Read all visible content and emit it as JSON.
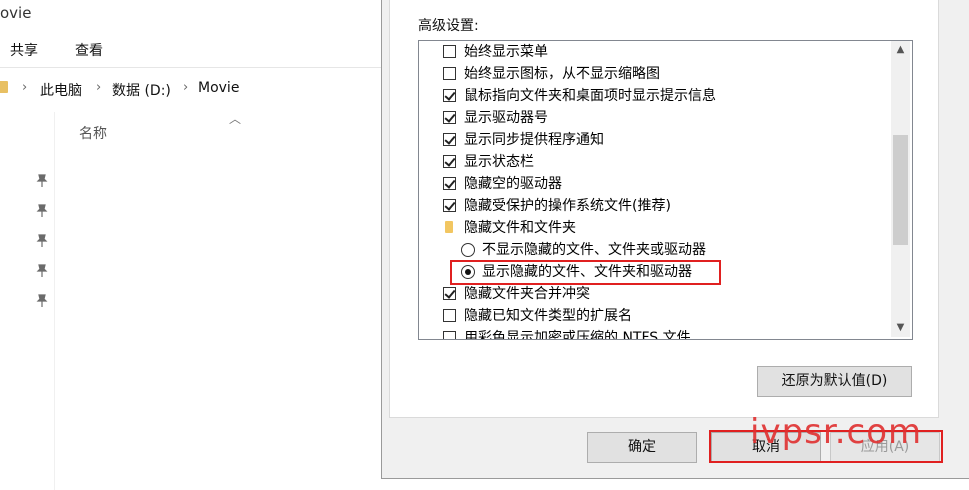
{
  "explorer": {
    "title": "ovie",
    "ribbon_tabs": [
      "共享",
      "查看"
    ],
    "breadcrumb": [
      "此电脑",
      "数据 (D:)",
      "Movie"
    ],
    "column_header": "名称",
    "pinned_count": 5
  },
  "dialog": {
    "advanced_label": "高级设置:",
    "items": [
      {
        "type": "checkbox",
        "checked": false,
        "label": "始终显示菜单"
      },
      {
        "type": "checkbox",
        "checked": false,
        "label": "始终显示图标，从不显示缩略图"
      },
      {
        "type": "checkbox",
        "checked": true,
        "label": "鼠标指向文件夹和桌面项时显示提示信息"
      },
      {
        "type": "checkbox",
        "checked": true,
        "label": "显示驱动器号"
      },
      {
        "type": "checkbox",
        "checked": true,
        "label": "显示同步提供程序通知"
      },
      {
        "type": "checkbox",
        "checked": true,
        "label": "显示状态栏"
      },
      {
        "type": "checkbox",
        "checked": true,
        "label": "隐藏空的驱动器"
      },
      {
        "type": "checkbox",
        "checked": true,
        "label": "隐藏受保护的操作系统文件(推荐)"
      },
      {
        "type": "folder",
        "label": "隐藏文件和文件夹"
      },
      {
        "type": "radio",
        "checked": false,
        "label": "不显示隐藏的文件、文件夹或驱动器"
      },
      {
        "type": "radio",
        "checked": true,
        "label": "显示隐藏的文件、文件夹和驱动器"
      },
      {
        "type": "checkbox",
        "checked": true,
        "label": "隐藏文件夹合并冲突"
      },
      {
        "type": "checkbox",
        "checked": false,
        "label": "隐藏已知文件类型的扩展名"
      },
      {
        "type": "checkbox",
        "checked": false,
        "label": "用彩色显示加密或压缩的 NTFS 文件"
      }
    ],
    "restore_defaults": "还原为默认值(D)",
    "ok": "确定",
    "cancel": "取消",
    "apply": "应用(A)"
  },
  "watermark": "ivpsr.com",
  "colors": {
    "highlight": "#e02020",
    "accent_folder": "#f2c661"
  }
}
